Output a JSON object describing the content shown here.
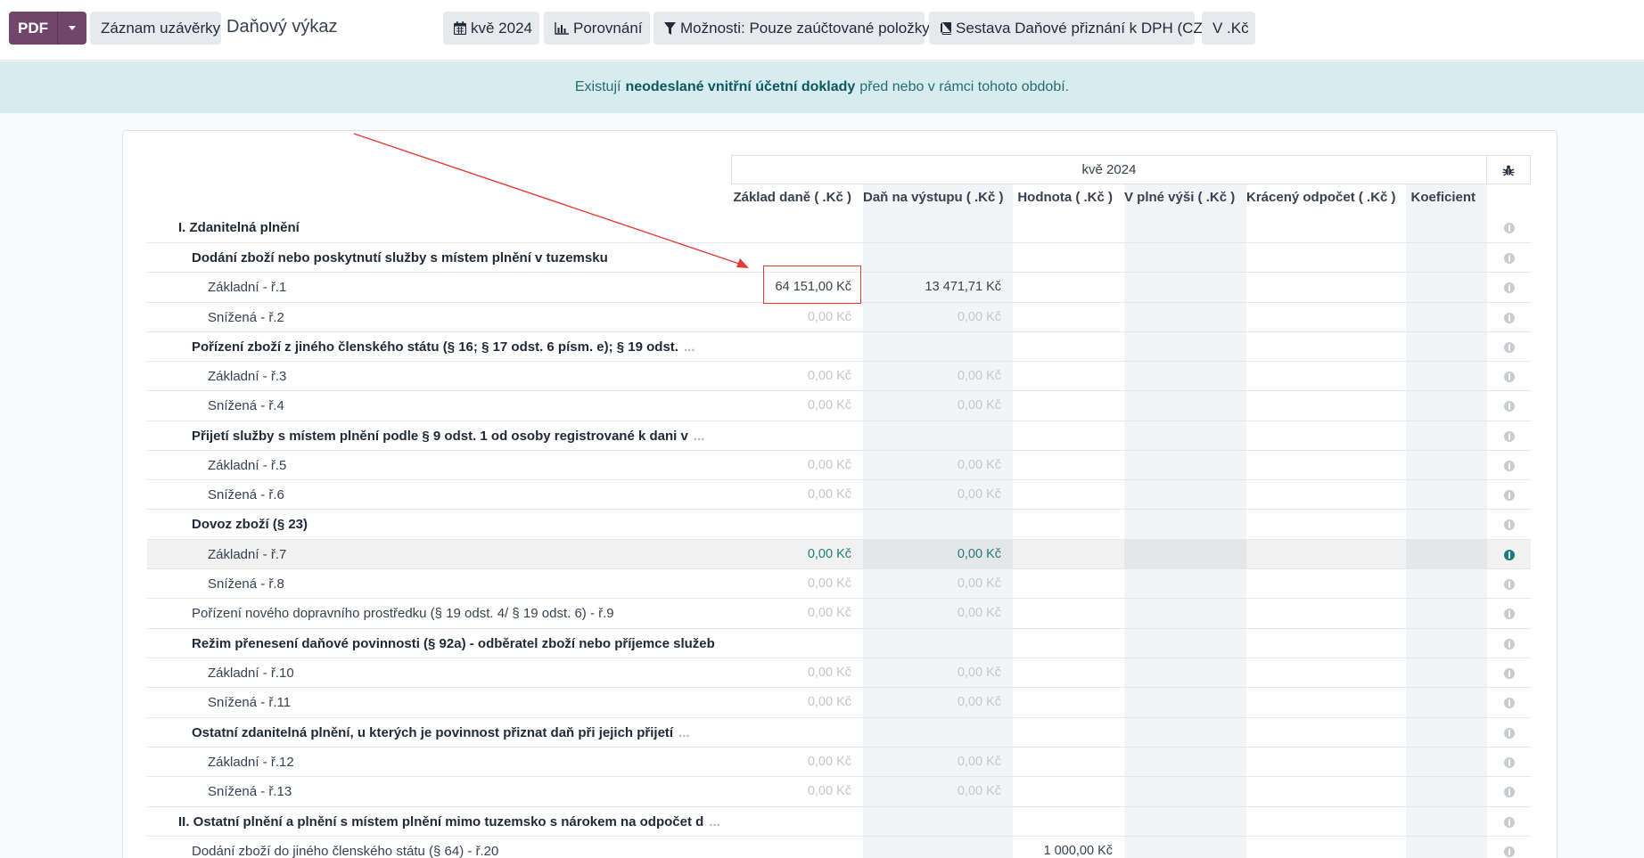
{
  "toolbar": {
    "pdf_label": "PDF",
    "closing_label": "Záznam uzávěrky",
    "title": "Daňový výkaz",
    "period_label": "kvě 2024",
    "compare_label": "Porovnání",
    "options_label": "Možnosti: Pouze zaúčtované položky",
    "report_label": "Sestava Daňové přiznání k DPH (CZ)",
    "currency_label": "V .Kč"
  },
  "alert": {
    "before": "Existují",
    "link": "neodeslané vnitřní účetní doklady",
    "after": "před nebo v rámci tohoto období."
  },
  "table": {
    "period": "kvě 2024",
    "columns": [
      "Základ daně ( .Kč )",
      "Daň na výstupu ( .Kč )",
      "Hodnota ( .Kč )",
      "V plné výši ( .Kč )",
      "Krácený odpočet ( .Kč )",
      "Koeficient"
    ],
    "rows": [
      {
        "label": "I. Zdanitelná plnění",
        "level": 0,
        "bold": true,
        "cells": [
          "",
          "",
          "",
          "",
          "",
          ""
        ]
      },
      {
        "label": "Dodání zboží nebo poskytnutí služby s místem plnění v tuzemsku",
        "level": 1,
        "bold": true,
        "cells": [
          "",
          "",
          "",
          "",
          "",
          ""
        ]
      },
      {
        "label": "Základní - ř.1",
        "level": 2,
        "bold": false,
        "cells": [
          "64 151,00 Kč",
          "13 471,71 Kč",
          "",
          "",
          "",
          ""
        ]
      },
      {
        "label": "Snížená - ř.2",
        "level": 2,
        "bold": false,
        "cells": [
          "0,00 Kč",
          "0,00 Kč",
          "",
          "",
          "",
          ""
        ]
      },
      {
        "label": "Pořízení zboží z jiného členského státu (§ 16; § 17 odst. 6 písm. e); § 19 odst.",
        "level": 1,
        "bold": true,
        "dots": "...",
        "cells": [
          "",
          "",
          "",
          "",
          "",
          ""
        ]
      },
      {
        "label": "Základní - ř.3",
        "level": 2,
        "bold": false,
        "cells": [
          "0,00 Kč",
          "0,00 Kč",
          "",
          "",
          "",
          ""
        ]
      },
      {
        "label": "Snížená - ř.4",
        "level": 2,
        "bold": false,
        "cells": [
          "0,00 Kč",
          "0,00 Kč",
          "",
          "",
          "",
          ""
        ]
      },
      {
        "label": "Přijetí služby s místem plnění podle § 9 odst. 1 od osoby registrované k dani v",
        "level": 1,
        "bold": true,
        "dots": "...",
        "cells": [
          "",
          "",
          "",
          "",
          "",
          ""
        ]
      },
      {
        "label": "Základní - ř.5",
        "level": 2,
        "bold": false,
        "cells": [
          "0,00 Kč",
          "0,00 Kč",
          "",
          "",
          "",
          ""
        ]
      },
      {
        "label": "Snížená - ř.6",
        "level": 2,
        "bold": false,
        "cells": [
          "0,00 Kč",
          "0,00 Kč",
          "",
          "",
          "",
          ""
        ]
      },
      {
        "label": "Dovoz zboží (§ 23)",
        "level": 1,
        "bold": true,
        "cells": [
          "",
          "",
          "",
          "",
          "",
          ""
        ]
      },
      {
        "label": "Základní - ř.7",
        "level": 2,
        "bold": false,
        "cells": [
          "0,00 Kč",
          "0,00 Kč",
          "",
          "",
          "",
          ""
        ]
      },
      {
        "label": "Snížená - ř.8",
        "level": 2,
        "bold": false,
        "cells": [
          "0,00 Kč",
          "0,00 Kč",
          "",
          "",
          "",
          ""
        ]
      },
      {
        "label": "Pořízení nového dopravního prostředku (§ 19 odst. 4/ § 19 odst. 6) - ř.9",
        "level": 1,
        "bold": false,
        "cells": [
          "0,00 Kč",
          "0,00 Kč",
          "",
          "",
          "",
          ""
        ]
      },
      {
        "label": "Režim přenesení daňové povinnosti (§ 92a) - odběratel zboží nebo příjemce služeb",
        "level": 1,
        "bold": true,
        "cells": [
          "",
          "",
          "",
          "",
          "",
          ""
        ]
      },
      {
        "label": "Základní - ř.10",
        "level": 2,
        "bold": false,
        "cells": [
          "0,00 Kč",
          "0,00 Kč",
          "",
          "",
          "",
          ""
        ]
      },
      {
        "label": "Snížená - ř.11",
        "level": 2,
        "bold": false,
        "cells": [
          "0,00 Kč",
          "0,00 Kč",
          "",
          "",
          "",
          ""
        ]
      },
      {
        "label": "Ostatní zdanitelná plnění, u kterých je povinnost přiznat daň při jejich přijetí",
        "level": 1,
        "bold": true,
        "dots": "...",
        "cells": [
          "",
          "",
          "",
          "",
          "",
          ""
        ]
      },
      {
        "label": "Základní - ř.12",
        "level": 2,
        "bold": false,
        "cells": [
          "0,00 Kč",
          "0,00 Kč",
          "",
          "",
          "",
          ""
        ]
      },
      {
        "label": "Snížená - ř.13",
        "level": 2,
        "bold": false,
        "cells": [
          "0,00 Kč",
          "0,00 Kč",
          "",
          "",
          "",
          ""
        ]
      },
      {
        "label": "II. Ostatní plnění a plnění s místem plnění mimo tuzemsko s nárokem na odpočet d",
        "level": 0,
        "bold": true,
        "dots": "...",
        "cells": [
          "",
          "",
          "",
          "",
          "",
          ""
        ]
      },
      {
        "label": "Dodání zboží do jiného členského státu (§ 64) - ř.20",
        "level": 1,
        "bold": false,
        "cells": [
          "",
          "",
          "1 000,00 Kč",
          "",
          "",
          ""
        ]
      }
    ]
  },
  "colors": {
    "pdf_button": "#71466b",
    "alert_bg": "#d7ecef",
    "alert_text": "#276a73",
    "annotation": "#e53935",
    "positive_value": "#1d7c7c"
  }
}
